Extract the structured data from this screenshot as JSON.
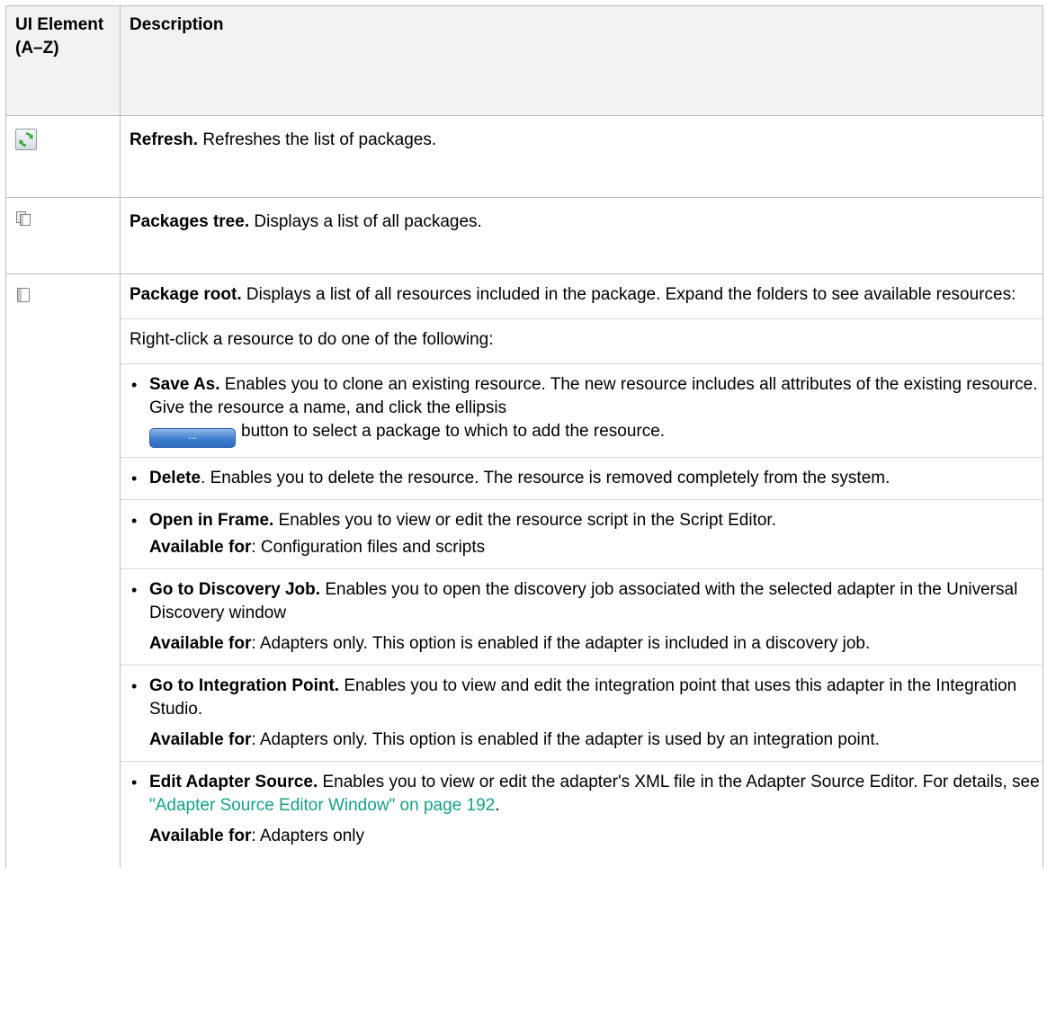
{
  "header": {
    "col1": "UI Element (A–Z)",
    "col2": "Description"
  },
  "rows": {
    "refresh": {
      "icon": "refresh-icon",
      "title": "Refresh.",
      "text": "Refreshes the list of packages."
    },
    "tree": {
      "icon": "packages-tree-icon",
      "title": "Packages tree.",
      "text": "Displays a list of all packages."
    },
    "root": {
      "icon": "package-root-icon",
      "title": "Package root.",
      "text": "Displays a list of all resources included in the package. Expand the folders to see available resources:",
      "intro": "Right-click a resource to do one of the following:",
      "options": {
        "save_as": {
          "title": "Save As.",
          "text_before": "Enables you to clone an existing resource. The new resource includes all attributes of the existing resource. Give the resource a name, and click the ellipsis",
          "button_label": "...",
          "text_after": "button to select a package to which to add the resource."
        },
        "delete": {
          "title": "Delete",
          "text": ". Enables you to delete the resource. The resource is removed completely from the system."
        },
        "open_in_frame": {
          "title": "Open in Frame.",
          "text": "Enables you to view or edit the resource script in the Script Editor.",
          "note_label": "Available for",
          "note_text": ": Configuration files and scripts"
        },
        "go_to_discovery_job": {
          "title": "Go to Discovery Job.",
          "text": "Enables you to open the discovery job associated with the selected adapter in the Universal Discovery window",
          "note_label": "Available for",
          "note_text": ": Adapters only. This option is enabled if the adapter is included in a discovery job."
        },
        "go_to_integration_point": {
          "title": "Go to Integration Point.",
          "text": "Enables you to view and edit the integration point that uses this adapter in the Integration Studio.",
          "note_label": "Available for",
          "note_text": ": Adapters only. This option is enabled if the adapter is used by an integration point."
        },
        "edit_adapter_source": {
          "title": "Edit Adapter Source.",
          "text": "Enables you to view or edit the adapter's XML file in the Adapter Source Editor. For details, see",
          "link": "\"Adapter Source Editor Window\" on page 192",
          "text_end": ".",
          "note_label": "Available for",
          "note_text": ": Adapters only"
        }
      }
    }
  },
  "colors": {
    "header_bg": "#f2f2f2",
    "border": "#bdbdbd",
    "link": "#16a085",
    "refresh_green": "#3aa83a"
  }
}
